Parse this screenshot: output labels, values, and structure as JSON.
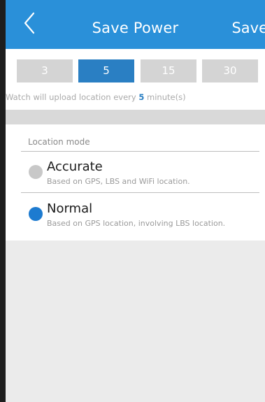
{
  "header": {
    "title": "Save Power",
    "save_label": "Save",
    "back_icon": "chevron-left-icon"
  },
  "interval": {
    "options": [
      "3",
      "5",
      "15",
      "30"
    ],
    "selected": "5",
    "note_prefix": "Watch will upload location every ",
    "note_value": "5",
    "note_suffix": " minute(s)"
  },
  "location_mode": {
    "section_label": "Location mode",
    "options": [
      {
        "name": "Accurate",
        "description": "Based on GPS, LBS and WiFi location.",
        "selected": false
      },
      {
        "name": "Normal",
        "description": "Based on GPS location, involving LBS location.",
        "selected": true
      }
    ]
  },
  "colors": {
    "header_bg": "#2a90d9",
    "accent": "#2a7fc3",
    "radio_on": "#1d7bd0",
    "radio_off": "#c8c8c8",
    "segment_off": "#d4d4d4",
    "background": "#ebebeb"
  }
}
